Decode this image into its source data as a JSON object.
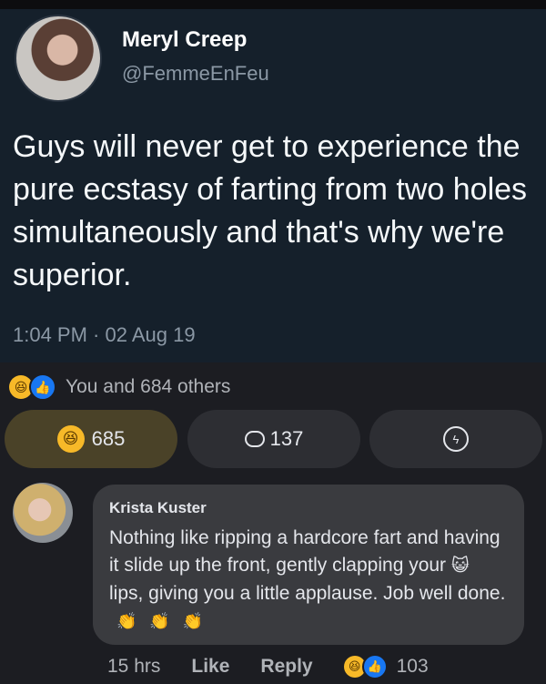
{
  "tweet": {
    "author_name": "Meryl Creep",
    "handle": "@FemmeEnFeu",
    "text": "Guys will never get to experience the pure ecstasy of farting from two holes simultaneously and that's why we're superior.",
    "timestamp": "1:04 PM · 02 Aug 19"
  },
  "reactions": {
    "summary": "You and 684 others",
    "icons": [
      "laugh-emoji",
      "like-icon"
    ]
  },
  "buttons": {
    "reaction_count": "685",
    "comment_count": "137",
    "share_icon": "messenger-icon"
  },
  "comment": {
    "author": "Krista Kuster",
    "text_part1": "Nothing like ripping a hardcore fart and having it slide up the front, gently clapping your",
    "text_part2": "lips, giving you a little applause. Job well done.",
    "emoji": "😺",
    "claps": [
      "👏",
      "👏",
      "👏"
    ],
    "time": "15 hrs",
    "like_label": "Like",
    "reply_label": "Reply",
    "reaction_count": "103"
  },
  "colors": {
    "tweet_bg": "#15202b",
    "page_bg": "#1c1d22",
    "laugh_active": "#4a4228",
    "like_blue": "#1877f2",
    "laugh_yellow": "#f7b928"
  }
}
